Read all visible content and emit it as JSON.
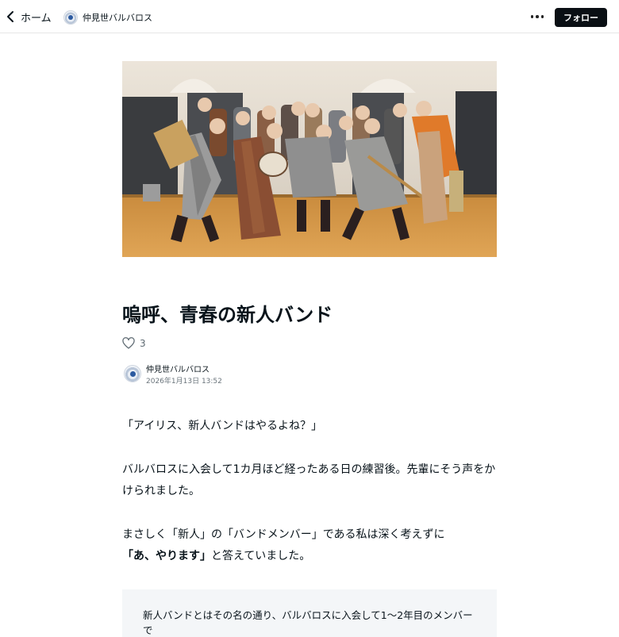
{
  "header": {
    "back_label": "ホーム",
    "creator_name": "仲見世バルバロス",
    "follow_label": "フォロー"
  },
  "article": {
    "title": "嗚呼、青春の新人バンド",
    "likes": "3",
    "author_name": "仲見世バルバロス",
    "published": "2026年1月13日 13:52",
    "p1": "「アイリス、新人バンドはやるよね？」",
    "p2_line1": "バルバロスに入会して1カ月ほど経ったある日の練習後。先輩にそう声をか",
    "p2_line2": "けられました。",
    "p3_line1": "まさしく「新人」の「バンドメンバー」である私は深く考えずに",
    "p3_bold": "「あ、やります」",
    "p3_rest": "と答えていました。",
    "box_text": "新人バンドとはその名の通り、バルバロスに入会して1〜2年目のメンバーで"
  },
  "icons": {
    "back": "chevron-left-icon",
    "more": "more-horizontal-icon",
    "like": "heart-icon"
  }
}
